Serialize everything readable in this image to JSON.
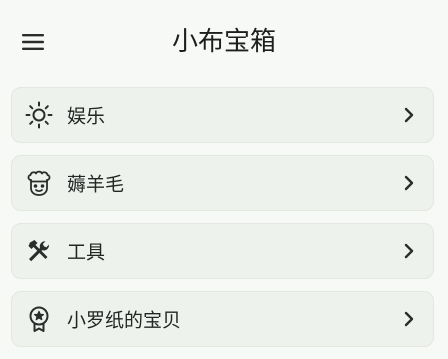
{
  "app_bar": {
    "title": "小布宝箱",
    "menu_icon": "hamburger-menu-icon"
  },
  "items": [
    {
      "label": "娱乐",
      "icon": "sun-icon"
    },
    {
      "label": "薅羊毛",
      "icon": "chef-face-icon"
    },
    {
      "label": "工具",
      "icon": "tools-icon"
    },
    {
      "label": "小罗纸的宝贝",
      "icon": "award-ribbon-icon"
    }
  ],
  "chevron_icon": "chevron-right-icon",
  "colors": {
    "background": "#f7f9f6",
    "card": "#eef2ec",
    "text": "#1e2120"
  }
}
